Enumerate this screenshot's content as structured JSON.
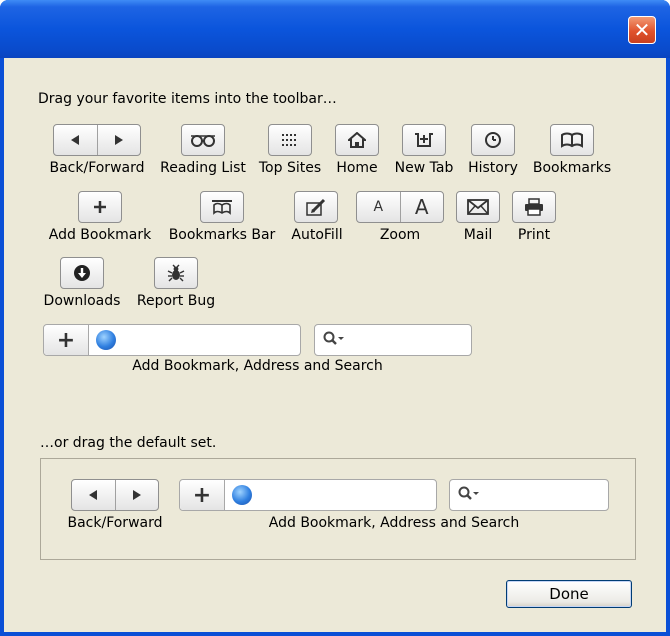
{
  "window": {
    "close_glyph": "✕"
  },
  "instructions": {
    "drag_items": "Drag your favorite items into the toolbar…",
    "drag_default": "…or drag the default set."
  },
  "items": [
    {
      "name": "back-forward",
      "label": "Back/Forward"
    },
    {
      "name": "reading-list",
      "label": "Reading List"
    },
    {
      "name": "top-sites",
      "label": "Top Sites"
    },
    {
      "name": "home",
      "label": "Home"
    },
    {
      "name": "new-tab",
      "label": "New Tab"
    },
    {
      "name": "history",
      "label": "History"
    },
    {
      "name": "bookmarks",
      "label": "Bookmarks"
    },
    {
      "name": "add-bookmark",
      "label": "Add Bookmark"
    },
    {
      "name": "bookmarks-bar",
      "label": "Bookmarks Bar"
    },
    {
      "name": "autofill",
      "label": "AutoFill"
    },
    {
      "name": "zoom",
      "label": "Zoom"
    },
    {
      "name": "mail",
      "label": "Mail"
    },
    {
      "name": "print",
      "label": "Print"
    },
    {
      "name": "downloads",
      "label": "Downloads"
    },
    {
      "name": "report-bug",
      "label": "Report Bug"
    },
    {
      "name": "address-search",
      "label": "Add Bookmark, Address and Search"
    }
  ],
  "zoom": {
    "small": "A",
    "large": "A"
  },
  "default_set": {
    "back_forward_label": "Back/Forward",
    "address_search_label": "Add Bookmark, Address and Search"
  },
  "buttons": {
    "done": "Done"
  },
  "colors": {
    "titlebar": "#0a4bcc",
    "client_bg": "#ece9d8",
    "close": "#e0532d"
  }
}
